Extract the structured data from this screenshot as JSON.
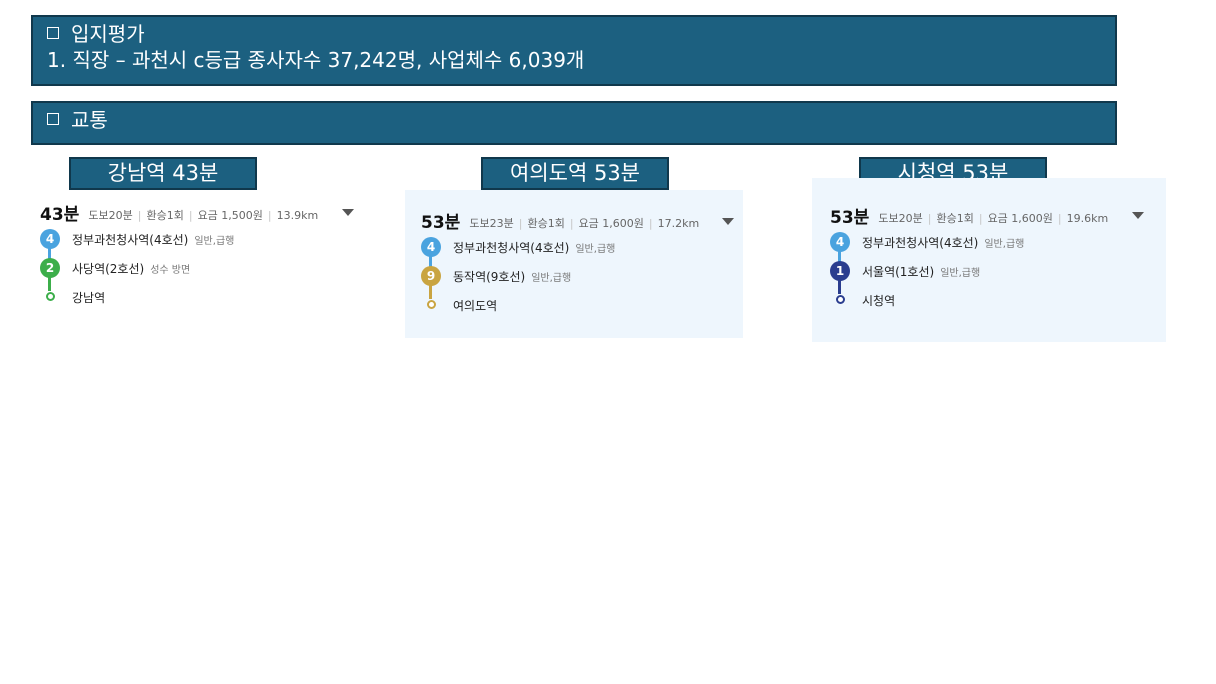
{
  "header": {
    "title": "입지평가",
    "subtitle": "1. 직장 – 과천시 c등급 종사자수 37,242명, 사업체수 6,039개"
  },
  "section": {
    "title": "교통"
  },
  "routes": [
    {
      "label": "강남역 43분",
      "time": "43분",
      "walk": "도보20분",
      "transfer": "환승1회",
      "fare": "요금 1,500원",
      "distance": "13.9km",
      "stops": [
        {
          "badge": "4",
          "name": "정부과천청사역(4호선)",
          "direction": "일반,급행",
          "color": "#4aa3df"
        },
        {
          "badge": "2",
          "name": "사당역(2호선)",
          "direction": "성수 방면",
          "color": "#3cae4a"
        },
        {
          "badge": "",
          "name": "강남역",
          "direction": "",
          "color": "#3cae4a"
        }
      ]
    },
    {
      "label": "여의도역 53분",
      "time": "53분",
      "walk": "도보23분",
      "transfer": "환승1회",
      "fare": "요금 1,600원",
      "distance": "17.2km",
      "stops": [
        {
          "badge": "4",
          "name": "정부과천청사역(4호선)",
          "direction": "일반,급행",
          "color": "#4aa3df"
        },
        {
          "badge": "9",
          "name": "동작역(9호선)",
          "direction": "일반,급행",
          "color": "#c9a441"
        },
        {
          "badge": "",
          "name": "여의도역",
          "direction": "",
          "color": "#c9a441"
        }
      ]
    },
    {
      "label": "시청역 53분",
      "time": "53분",
      "walk": "도보20분",
      "transfer": "환승1회",
      "fare": "요금 1,600원",
      "distance": "19.6km",
      "stops": [
        {
          "badge": "4",
          "name": "정부과천청사역(4호선)",
          "direction": "일반,급행",
          "color": "#4aa3df"
        },
        {
          "badge": "1",
          "name": "서울역(1호선)",
          "direction": "일반,급행",
          "color": "#2a3d8f"
        },
        {
          "badge": "",
          "name": "시청역",
          "direction": "",
          "color": "#2a3d8f"
        }
      ]
    }
  ],
  "colors": {
    "banner_bg": "#1c6080",
    "banner_border": "#10384c",
    "card_bg": "#eef6fd"
  },
  "icons": {
    "bullet": "square-bullet-icon",
    "expand": "caret-down-icon"
  }
}
